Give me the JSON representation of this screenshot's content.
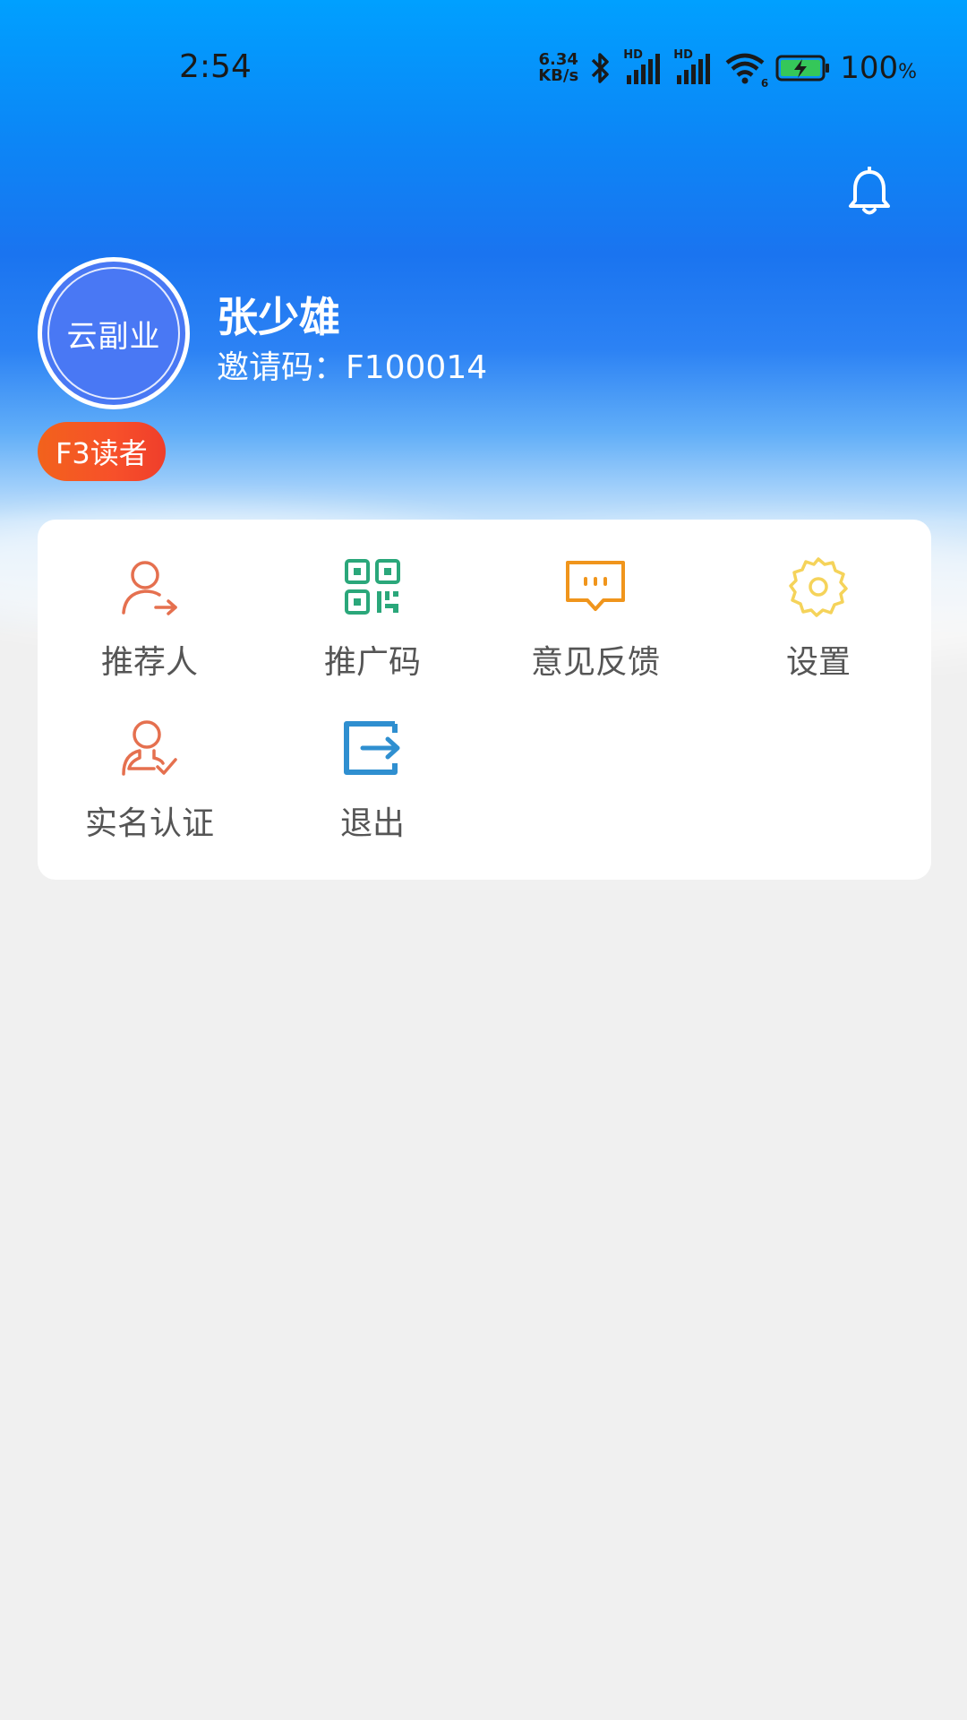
{
  "status_bar": {
    "time": "2:54",
    "net_speed_value": "6.34",
    "net_speed_unit": "KB/s",
    "signal_label": "HD",
    "signal_label_2": "HD",
    "wifi_sub": "6",
    "battery_value": "100",
    "battery_unit": "%"
  },
  "profile": {
    "avatar_text": "云副业",
    "name": "张少雄",
    "invite_label": "邀请码：",
    "invite_code": "F100014",
    "level_badge": "F3读者"
  },
  "menu": {
    "items": [
      {
        "label": "推荐人",
        "icon": "referrer-icon",
        "color": "#e5704f"
      },
      {
        "label": "推广码",
        "icon": "qr-code-icon",
        "color": "#2aa77a"
      },
      {
        "label": "意见反馈",
        "icon": "feedback-chat-icon",
        "color": "#f0951c"
      },
      {
        "label": "设置",
        "icon": "gear-icon",
        "color": "#f5d35a"
      },
      {
        "label": "实名认证",
        "icon": "verified-user-icon",
        "color": "#e5704f"
      },
      {
        "label": "退出",
        "icon": "logout-icon",
        "color": "#2f8fd0"
      }
    ]
  },
  "colors": {
    "header_blue": "#1a74f0",
    "badge_orange": "#f2621c",
    "avatar_blue": "#4978f4",
    "page_background": "#f0f0f0"
  }
}
